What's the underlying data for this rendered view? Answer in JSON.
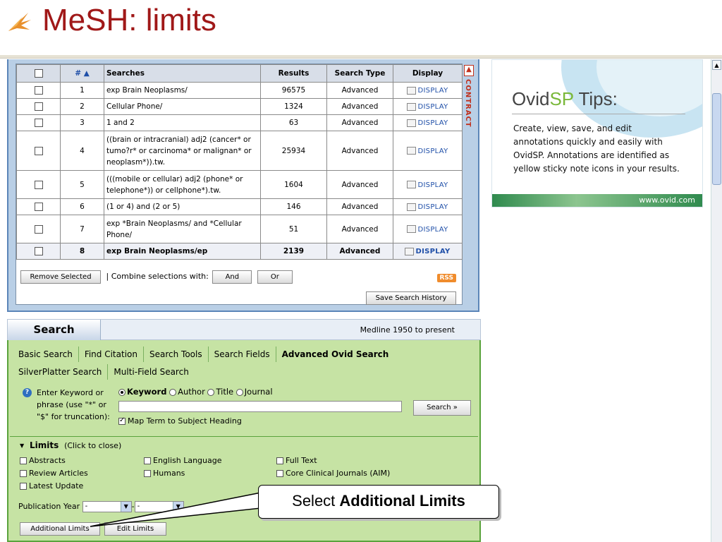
{
  "slide": {
    "title": "MeSH: limits",
    "logo_icon": "orange-leaf-logo"
  },
  "history": {
    "columns": [
      "",
      "# ▲",
      "Searches",
      "Results",
      "Search Type",
      "Display"
    ],
    "rows": [
      {
        "num": "1",
        "search": "exp Brain Neoplasms/",
        "results": "96575",
        "type": "Advanced",
        "display": "DISPLAY"
      },
      {
        "num": "2",
        "search": "Cellular Phone/",
        "results": "1324",
        "type": "Advanced",
        "display": "DISPLAY"
      },
      {
        "num": "3",
        "search": "1 and 2",
        "results": "63",
        "type": "Advanced",
        "display": "DISPLAY"
      },
      {
        "num": "4",
        "search": "((brain or intracranial) adj2 (cancer* or tumo?r* or carcinoma* or malignan* or neoplasm*)).tw.",
        "results": "25934",
        "type": "Advanced",
        "display": "DISPLAY"
      },
      {
        "num": "5",
        "search": "(((mobile or cellular) adj2 (phone* or telephone*)) or cellphone*).tw.",
        "results": "1604",
        "type": "Advanced",
        "display": "DISPLAY"
      },
      {
        "num": "6",
        "search": "(1 or 4) and (2 or 5)",
        "results": "146",
        "type": "Advanced",
        "display": "DISPLAY"
      },
      {
        "num": "7",
        "search": "exp *Brain Neoplasms/ and *Cellular Phone/",
        "results": "51",
        "type": "Advanced",
        "display": "DISPLAY"
      },
      {
        "num": "8",
        "search": "exp Brain Neoplasms/ep",
        "results": "2139",
        "type": "Advanced",
        "display": "DISPLAY"
      }
    ],
    "remove_selected": "Remove Selected",
    "combine_label": "| Combine selections with:",
    "and_label": "And",
    "or_label": "Or",
    "rss_label": "RSS",
    "save_history": "Save Search History",
    "contract_label": "CONTRACT"
  },
  "tips": {
    "brand_a": "Ovid",
    "brand_b": "SP",
    "brand_c": " Tips:",
    "body": "Create, view, save, and edit annotations quickly and easily with OvidSP. Annotations are identified as yellow sticky note icons in your results.",
    "footer": "www.ovid.com"
  },
  "search": {
    "tab_label": "Search",
    "database": "Medline 1950 to present",
    "tabs_row1": [
      "Basic Search",
      "Find Citation",
      "Search Tools",
      "Search Fields",
      "Advanced Ovid Search"
    ],
    "tabs_row2": [
      "SilverPlatter Search",
      "Multi-Field Search"
    ],
    "active_tab": "Advanced Ovid Search",
    "help_icon": "question-icon",
    "prompt": "Enter Keyword or phrase (use \"*\" or \"$\" for truncation):",
    "radios": [
      {
        "label": "Keyword",
        "checked": true
      },
      {
        "label": "Author",
        "checked": false
      },
      {
        "label": "Title",
        "checked": false
      },
      {
        "label": "Journal",
        "checked": false
      }
    ],
    "query_value": "",
    "search_button": "Search »",
    "map_term": "Map Term to Subject Heading",
    "map_term_checked": true
  },
  "limits": {
    "title": "Limits",
    "hint": "(Click to close)",
    "items": [
      {
        "label": "Abstracts",
        "checked": false
      },
      {
        "label": "English Language",
        "checked": false
      },
      {
        "label": "Full Text",
        "checked": false
      },
      {
        "label": "Review Articles",
        "checked": false
      },
      {
        "label": "Humans",
        "checked": false
      },
      {
        "label": "Core Clinical Journals (AIM)",
        "checked": false
      },
      {
        "label": "Latest Update",
        "checked": false
      }
    ],
    "pub_year_label": "Publication Year",
    "year_from": "-",
    "year_sep": "-",
    "year_to": "-",
    "additional_limits": "Additional Limits",
    "edit_limits": "Edit Limits"
  },
  "callout": {
    "prefix": "Select ",
    "bold": "Additional Limits"
  }
}
